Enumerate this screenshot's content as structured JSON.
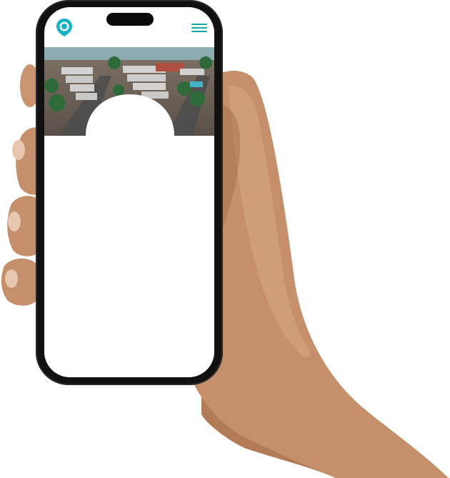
{
  "page": {
    "background": "#ffffff"
  },
  "phone": {
    "frame_color": "#111111",
    "screen_color": "#ffffff"
  },
  "app": {
    "logo_icon": "location-pin-icon",
    "brand_color": "#13a7a7",
    "menu_icon": "hamburger-menu-icon"
  },
  "hero": {
    "image": "aerial-neighborhood-photo"
  }
}
